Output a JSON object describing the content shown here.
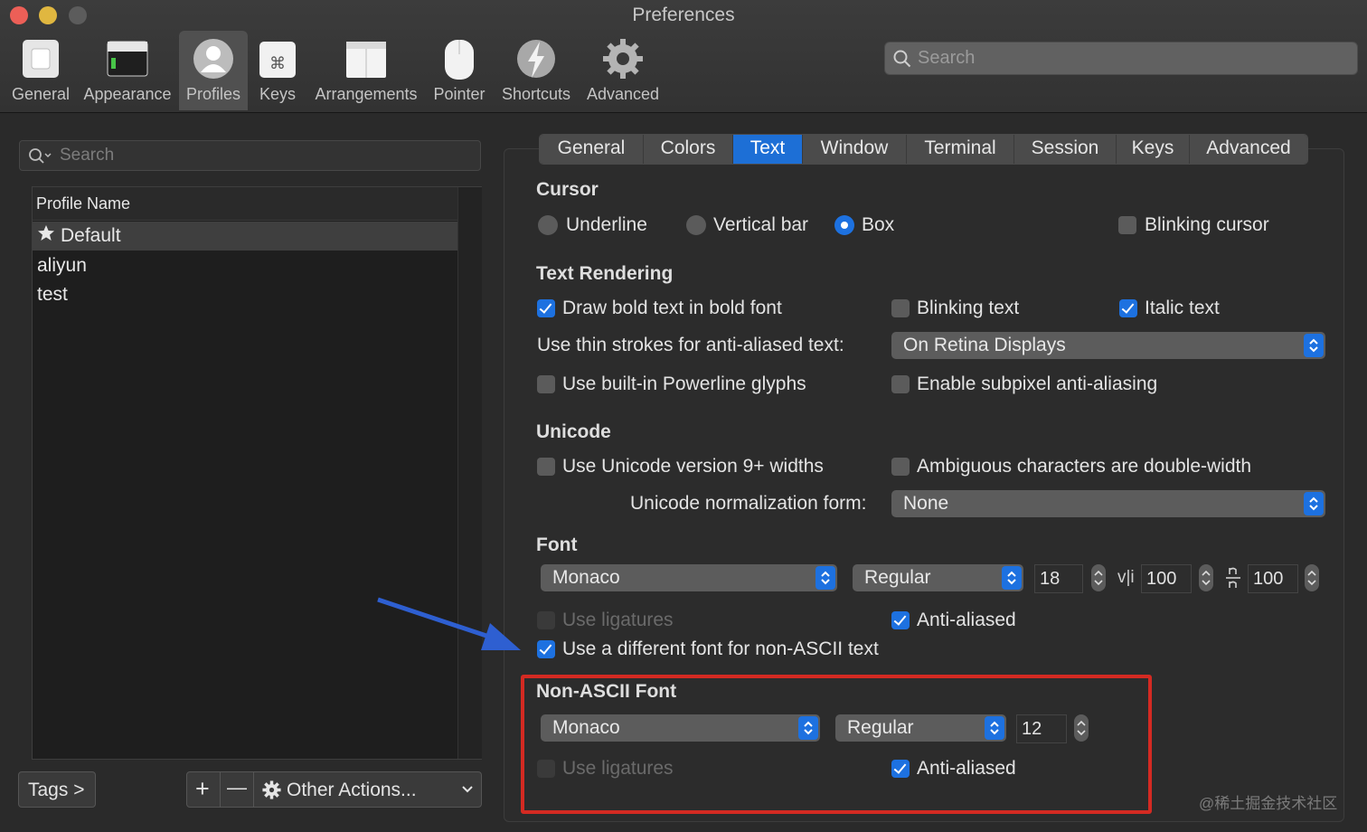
{
  "window": {
    "title": "Preferences"
  },
  "toolbar": {
    "items": [
      {
        "label": "General",
        "icon": "general-switch-icon"
      },
      {
        "label": "Appearance",
        "icon": "appearance-window-icon"
      },
      {
        "label": "Profiles",
        "icon": "profile-person-icon",
        "selected": true
      },
      {
        "label": "Keys",
        "icon": "command-key-icon"
      },
      {
        "label": "Arrangements",
        "icon": "arrangements-window-icon"
      },
      {
        "label": "Pointer",
        "icon": "mouse-pointer-icon"
      },
      {
        "label": "Shortcuts",
        "icon": "lightning-bolt-icon"
      },
      {
        "label": "Advanced",
        "icon": "gear-icon"
      }
    ],
    "search_placeholder": "Search"
  },
  "profiles": {
    "search_placeholder": "Search",
    "column_header": "Profile Name",
    "rows": [
      {
        "name": "Default",
        "starred": true,
        "selected": true
      },
      {
        "name": "aliyun"
      },
      {
        "name": "test"
      }
    ],
    "tags_label": "Tags >",
    "add_symbol": "+",
    "remove_symbol": "—",
    "other_actions_label": "Other Actions..."
  },
  "tabs": [
    {
      "label": "General"
    },
    {
      "label": "Colors"
    },
    {
      "label": "Text",
      "selected": true
    },
    {
      "label": "Window"
    },
    {
      "label": "Terminal"
    },
    {
      "label": "Session"
    },
    {
      "label": "Keys"
    },
    {
      "label": "Advanced"
    }
  ],
  "cursor": {
    "heading": "Cursor",
    "underline": "Underline",
    "vertical_bar": "Vertical bar",
    "box": "Box",
    "selected": "Box",
    "blinking_cursor": {
      "label": "Blinking cursor",
      "checked": false
    }
  },
  "text_rendering": {
    "heading": "Text Rendering",
    "bold": {
      "label": "Draw bold text in bold font",
      "checked": true
    },
    "blinking_text": {
      "label": "Blinking text",
      "checked": false
    },
    "italic": {
      "label": "Italic text",
      "checked": true
    },
    "thin_strokes_label": "Use thin strokes for anti-aliased text:",
    "thin_strokes_value": "On Retina Displays",
    "powerline": {
      "label": "Use built-in Powerline glyphs",
      "checked": false
    },
    "subpixel": {
      "label": "Enable subpixel anti-aliasing",
      "checked": false
    }
  },
  "unicode": {
    "heading": "Unicode",
    "version9": {
      "label": "Use Unicode version 9+ widths",
      "checked": false
    },
    "ambiguous": {
      "label": "Ambiguous characters are double-width",
      "checked": false
    },
    "normalization_label": "Unicode normalization form:",
    "normalization_value": "None"
  },
  "font": {
    "heading": "Font",
    "family": "Monaco",
    "style": "Regular",
    "size": "18",
    "vspacing": "100",
    "hspacing": "100",
    "ligatures": {
      "label": "Use ligatures",
      "checked": false,
      "disabled": true
    },
    "antialiased": {
      "label": "Anti-aliased",
      "checked": true
    },
    "non_ascii_toggle": {
      "label": "Use a different font for non-ASCII text",
      "checked": true
    }
  },
  "non_ascii_font": {
    "heading": "Non-ASCII Font",
    "family": "Monaco",
    "style": "Regular",
    "size": "12",
    "ligatures": {
      "label": "Use ligatures",
      "checked": false,
      "disabled": true
    },
    "antialiased": {
      "label": "Anti-aliased",
      "checked": true
    }
  },
  "annotations": {
    "arrow_color": "#2e5fd1",
    "box_color": "#d42a22"
  },
  "watermark": "@稀土掘金技术社区"
}
